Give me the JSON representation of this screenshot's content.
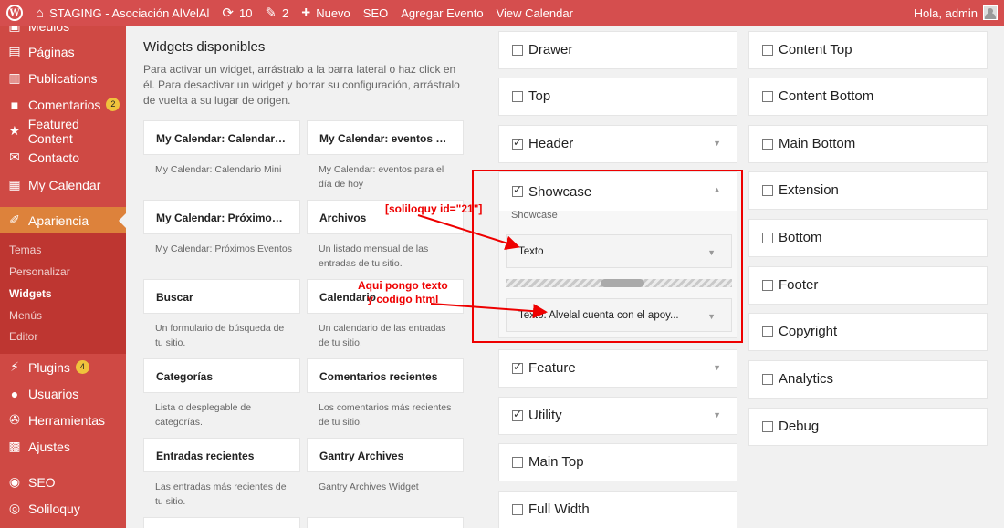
{
  "adminbar": {
    "site_name": "STAGING - Asociación AlVelAl",
    "updates": "10",
    "comments": "2",
    "new": "Nuevo",
    "seo": "SEO",
    "add_event": "Agregar Evento",
    "view_calendar": "View Calendar",
    "greeting": "Hola, admin"
  },
  "sidebar": {
    "items": [
      {
        "label": "Medios",
        "icon": "media-icon"
      },
      {
        "label": "Páginas",
        "icon": "pages-icon"
      },
      {
        "label": "Publications",
        "icon": "publications-icon"
      },
      {
        "label": "Comentarios",
        "icon": "comments-icon",
        "badge": "2"
      },
      {
        "label": "Featured Content",
        "icon": "star-icon"
      },
      {
        "label": "Contacto",
        "icon": "mail-icon"
      },
      {
        "label": "My Calendar",
        "icon": "calendar-icon"
      },
      {
        "label": "Apariencia",
        "icon": "brush-icon"
      },
      {
        "label": "Plugins",
        "icon": "plugin-icon",
        "badge": "4"
      },
      {
        "label": "Usuarios",
        "icon": "users-icon"
      },
      {
        "label": "Herramientas",
        "icon": "tools-icon"
      },
      {
        "label": "Ajustes",
        "icon": "settings-icon"
      },
      {
        "label": "SEO",
        "icon": "seo-icon"
      },
      {
        "label": "Soliloquy",
        "icon": "soliloquy-icon"
      }
    ],
    "submenu": [
      "Temas",
      "Personalizar",
      "Widgets",
      "Menús",
      "Editor"
    ]
  },
  "available": {
    "title": "Widgets disponibles",
    "description": "Para activar un widget, arrástralo a la barra lateral o haz click en él. Para desactivar un widget y borrar su configuración, arrástralo de vuelta a su lugar de origen.",
    "widgets": [
      {
        "title": "My Calendar: Calendario ...",
        "desc": "My Calendar: Calendario Mini"
      },
      {
        "title": "My Calendar: eventos par...",
        "desc": "My Calendar: eventos para el día de hoy"
      },
      {
        "title": "My Calendar: Próximos E...",
        "desc": "My Calendar: Próximos Eventos"
      },
      {
        "title": "Archivos",
        "desc": "Un listado mensual de las entradas de tu sitio."
      },
      {
        "title": "Buscar",
        "desc": "Un formulario de búsqueda de tu sitio."
      },
      {
        "title": "Calendario",
        "desc": "Un calendario de las entradas de tu sitio."
      },
      {
        "title": "Categorías",
        "desc": "Lista o desplegable de categorías."
      },
      {
        "title": "Comentarios recientes",
        "desc": "Los comentarios más recientes de tu sitio."
      },
      {
        "title": "Entradas recientes",
        "desc": "Las entradas más recientes de tu sitio."
      },
      {
        "title": "Gantry Archives",
        "desc": "Gantry Archives Widget"
      },
      {
        "title": "",
        "desc": ""
      },
      {
        "title": "",
        "desc": ""
      }
    ]
  },
  "areas_col1": [
    {
      "label": "Drawer",
      "checked": false,
      "arrow": false
    },
    {
      "label": "Top",
      "checked": false,
      "arrow": false
    },
    {
      "label": "Header",
      "checked": true,
      "arrow": true
    },
    {
      "label": "Feature",
      "checked": true,
      "arrow": true
    },
    {
      "label": "Utility",
      "checked": true,
      "arrow": true
    },
    {
      "label": "Main Top",
      "checked": false,
      "arrow": false
    },
    {
      "label": "Full Width",
      "checked": false,
      "arrow": false
    }
  ],
  "showcase": {
    "label": "Showcase",
    "description": "Showcase",
    "widget1": "Texto",
    "widget2": "Texto: Alvelal cuenta con el apoy..."
  },
  "areas_col2": [
    {
      "label": "Content Top"
    },
    {
      "label": "Content Bottom"
    },
    {
      "label": "Main Bottom"
    },
    {
      "label": "Extension"
    },
    {
      "label": "Bottom"
    },
    {
      "label": "Footer"
    },
    {
      "label": "Copyright"
    },
    {
      "label": "Analytics"
    },
    {
      "label": "Debug"
    }
  ],
  "annotations": {
    "shortcode": "[soliloquy id=\"21\"]",
    "note_line1": "Aqui pongo texto",
    "note_line2": "y codigo html"
  }
}
